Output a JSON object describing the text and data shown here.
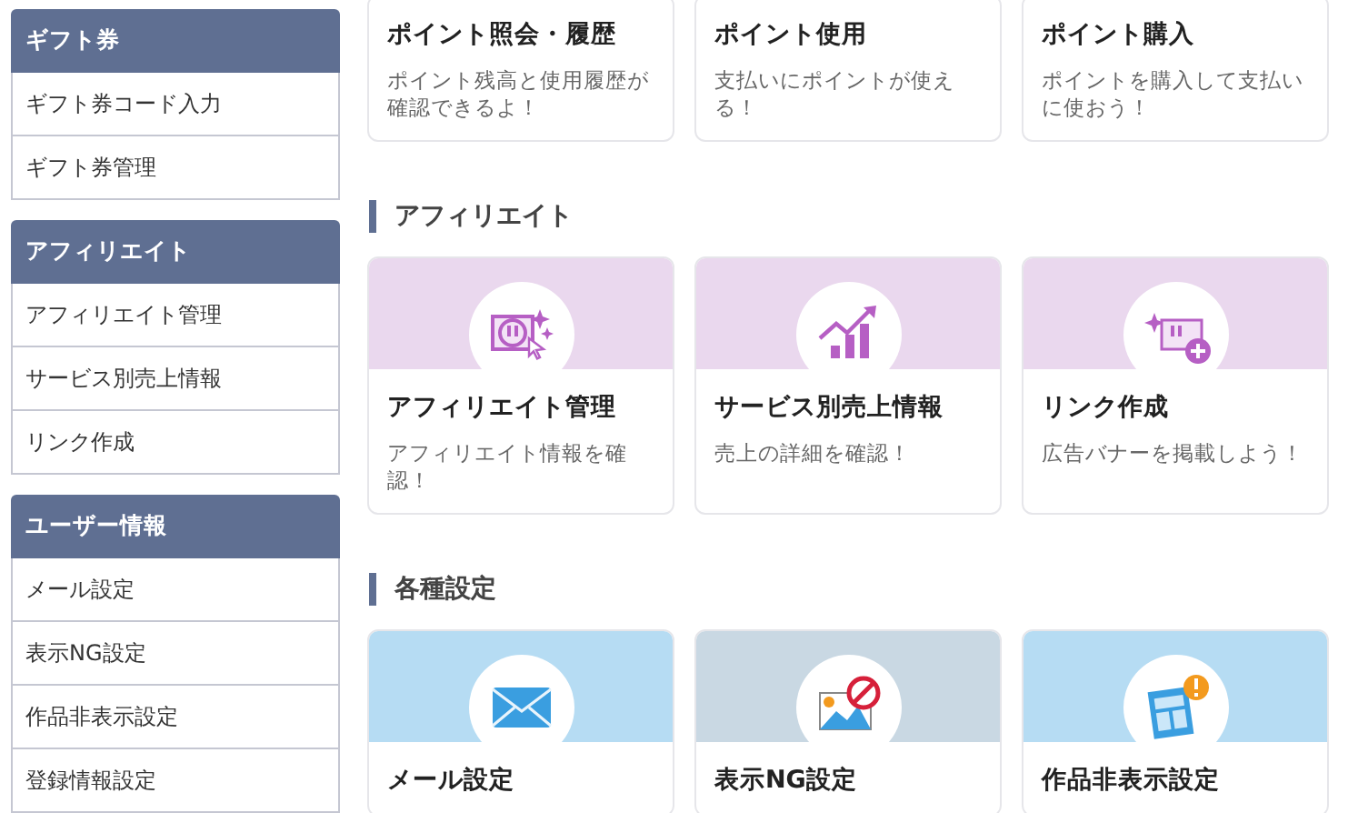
{
  "sidebar": {
    "groups": [
      {
        "title": "ギフト券",
        "items": [
          "ギフト券コード入力",
          "ギフト券管理"
        ]
      },
      {
        "title": "アフィリエイト",
        "items": [
          "アフィリエイト管理",
          "サービス別売上情報",
          "リンク作成"
        ]
      },
      {
        "title": "ユーザー情報",
        "items": [
          "メール設定",
          "表示NG設定",
          "作品非表示設定",
          "登録情報設定"
        ]
      }
    ]
  },
  "sections": [
    {
      "cards": [
        {
          "title": "ポイント照会・履歴",
          "description": "ポイント残高と使用履歴が確認できるよ！"
        },
        {
          "title": "ポイント使用",
          "description": "支払いにポイントが使える！"
        },
        {
          "title": "ポイント購入",
          "description": "ポイントを購入して支払いに使おう！"
        }
      ]
    },
    {
      "title": "アフィリエイト",
      "cards": [
        {
          "title": "アフィリエイト管理",
          "description": "アフィリエイト情報を確認！",
          "color": "#ead8ee"
        },
        {
          "title": "サービス別売上情報",
          "description": "売上の詳細を確認！",
          "color": "#ead8ee"
        },
        {
          "title": "リンク作成",
          "description": "広告バナーを掲載しよう！",
          "color": "#ead8ee"
        }
      ]
    },
    {
      "title": "各種設定",
      "cards": [
        {
          "title": "メール設定",
          "color": "#b6dcf3"
        },
        {
          "title": "表示NG設定",
          "color": "#c9d8e3"
        },
        {
          "title": "作品非表示設定",
          "color": "#b6dcf3"
        }
      ]
    }
  ]
}
